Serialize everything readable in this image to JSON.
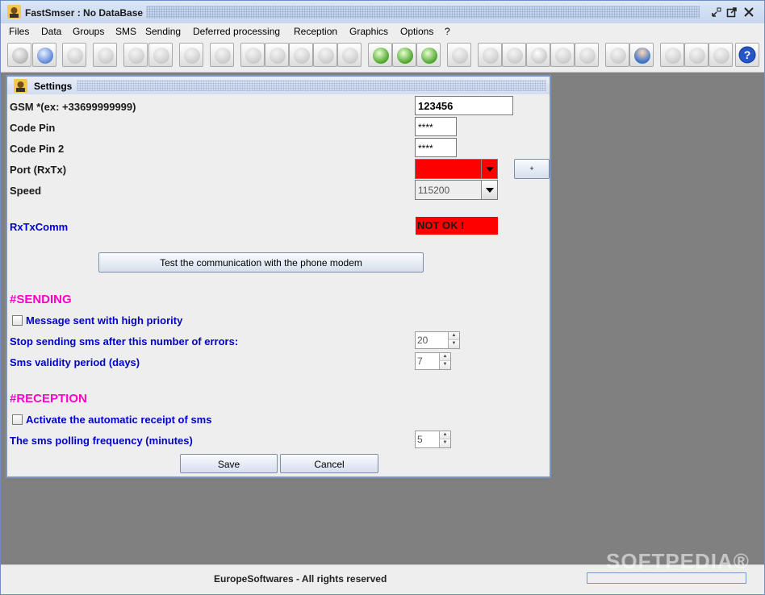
{
  "window": {
    "title": "FastSmser : No DataBase"
  },
  "menu": [
    "Files",
    "Data",
    "Groups",
    "SMS",
    "Sending",
    "Deferred processing",
    "Reception",
    "Graphics",
    "Options",
    "?"
  ],
  "toolbar_icons": [
    "database-icon",
    "database-globe-icon",
    "document-arrow-icon",
    "documents-icon",
    "contact-card-icon",
    "contact-minus-icon",
    "group-icon",
    "search-icon",
    "phone-icon",
    "phone-2-icon",
    "phone-3-icon",
    "phone-4-icon",
    "phone-5-icon",
    "sms-add-icon",
    "sms-edit-icon",
    "sms-delete-icon",
    "envelope-icon",
    "clock-icon",
    "clock-2-icon",
    "alarm-clock-icon",
    "check-icon",
    "cross-icon",
    "dial-icon",
    "user-icon",
    "graphic-icon",
    "graphic-2-icon",
    "graphic-3-icon",
    "help-icon"
  ],
  "settings": {
    "title": "Settings",
    "gsm_label": "GSM  *(ex: +33699999999)",
    "gsm_value": "123456",
    "pin_label": "Code Pin",
    "pin_value": "****",
    "pin2_label": "Code Pin 2",
    "pin2_value": "****",
    "port_label": "Port (RxTx)",
    "port_value": "",
    "port_add": "+",
    "speed_label": "Speed",
    "speed_value": "115200",
    "rxtx_label": "RxTxComm",
    "rxtx_status": "NOT OK !",
    "test_button": "Test the communication with the phone modem",
    "sending_header": "#SENDING",
    "priority_label": "Message sent with high priority",
    "errors_label": "Stop sending sms after this number of errors:",
    "errors_value": "20",
    "validity_label": "Sms validity period (days)",
    "validity_value": "7",
    "reception_header": "#RECEPTION",
    "auto_receipt_label": "Activate the automatic receipt of sms",
    "polling_label": "The sms polling frequency (minutes)",
    "polling_value": "5",
    "save_button": "Save",
    "cancel_button": "Cancel"
  },
  "status": {
    "copyright": "EuropeSoftwares - All rights reserved"
  },
  "watermark": "SOFTPEDIA®",
  "colors": {
    "error_red": "#ff0000",
    "label_blue": "#0000cc",
    "header_pink": "#ff00cc",
    "desktop_gray": "#808080"
  }
}
